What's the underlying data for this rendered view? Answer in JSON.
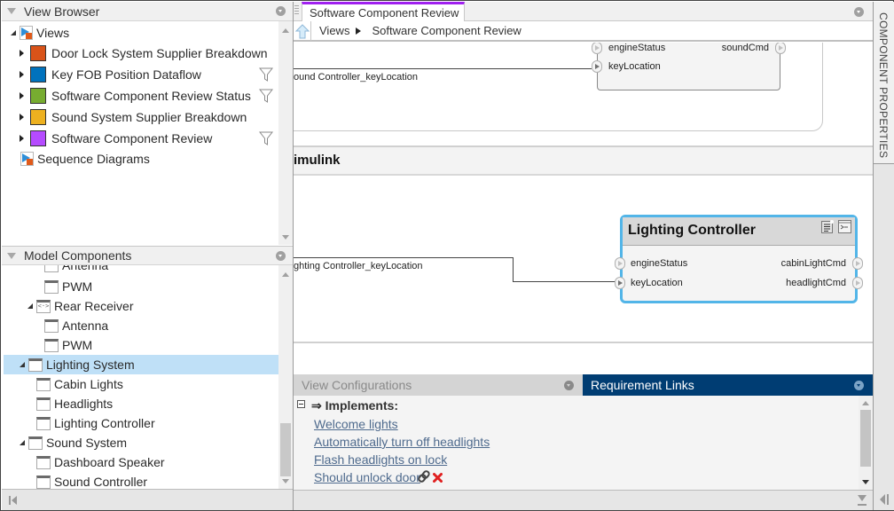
{
  "view_browser": {
    "title": "View Browser",
    "root": "Views",
    "views": [
      {
        "label": "Door Lock System Supplier Breakdown",
        "color": "#d95319",
        "filtered": false
      },
      {
        "label": "Key FOB Position Dataflow",
        "color": "#0072bd",
        "filtered": true
      },
      {
        "label": "Software Component Review Status",
        "color": "#77ac30",
        "filtered": true
      },
      {
        "label": "Sound System Supplier Breakdown",
        "color": "#edb120",
        "filtered": false
      },
      {
        "label": "Software Component Review",
        "color": "#b54bff",
        "filtered": true
      }
    ],
    "sequence_diagrams": "Sequence Diagrams"
  },
  "model_components": {
    "title": "Model Components",
    "items": [
      {
        "label": "Antenna",
        "level": 3,
        "partial": true
      },
      {
        "label": "PWM",
        "level": 3
      },
      {
        "label": "Rear Receiver",
        "level": 2,
        "expanded": true,
        "reference": true
      },
      {
        "label": "Antenna",
        "level": 3
      },
      {
        "label": "PWM",
        "level": 3
      },
      {
        "label": "Lighting System",
        "level": 1,
        "expanded": true,
        "selected": true
      },
      {
        "label": "Cabin Lights",
        "level": 2
      },
      {
        "label": "Headlights",
        "level": 2
      },
      {
        "label": "Lighting Controller",
        "level": 2
      },
      {
        "label": "Sound System",
        "level": 1,
        "expanded": true
      },
      {
        "label": "Dashboard Speaker",
        "level": 2
      },
      {
        "label": "Sound Controller",
        "level": 2
      }
    ]
  },
  "editor": {
    "tab_label": "Software Component Review",
    "tab_accent": "#a020f0",
    "breadcrumb": [
      "Views",
      "Software Component Review"
    ],
    "section_title": "imulink",
    "sound_block": {
      "inputs": [
        "engineStatus",
        "keyLocation"
      ],
      "outputs": [
        "soundCmd"
      ],
      "wire_label": "ound Controller_keyLocation"
    },
    "lighting_block": {
      "title": "Lighting Controller",
      "inputs": [
        "engineStatus",
        "keyLocation"
      ],
      "outputs": [
        "cabinLightCmd",
        "headlightCmd"
      ],
      "wire_label": "ghting Controller_keyLocation",
      "border_color": "#52b5e8"
    }
  },
  "bottom_panel": {
    "tabs": [
      {
        "label": "View Configurations",
        "active": false
      },
      {
        "label": "Requirement Links",
        "active": true
      }
    ],
    "active_color": "#003d73",
    "implements_label": "Implements:",
    "links": [
      "Welcome lights",
      "Automatically turn off headlights",
      "Flash headlights on lock",
      "Should unlock door"
    ]
  },
  "right_strip": {
    "component_properties": "COMPONENT PROPERTIES"
  }
}
